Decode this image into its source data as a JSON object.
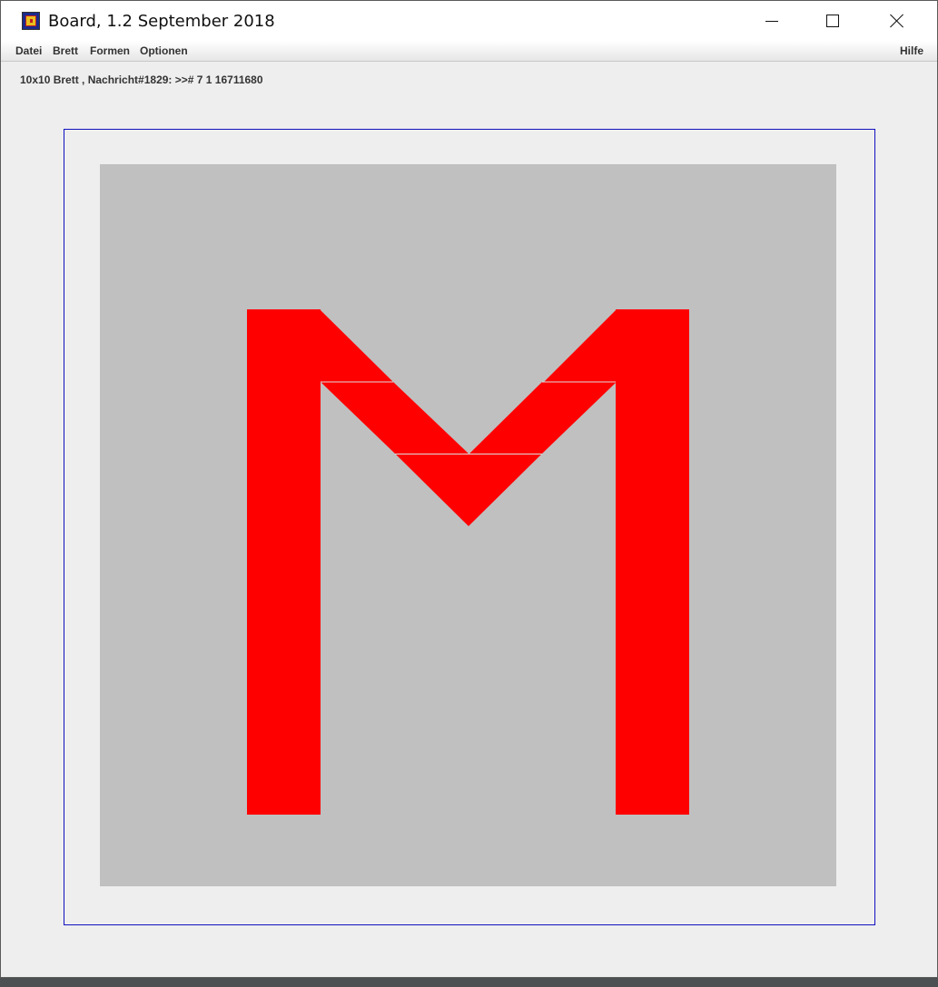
{
  "window": {
    "title": "Board, 1.2 September 2018",
    "icon": "board-app-icon",
    "controls": {
      "minimize": "minimize-icon",
      "maximize": "maximize-icon",
      "close": "close-icon"
    }
  },
  "menubar": {
    "items": [
      {
        "label": "Datei"
      },
      {
        "label": "Brett"
      },
      {
        "label": "Formen"
      },
      {
        "label": "Optionen"
      }
    ],
    "help_label": "Hilfe"
  },
  "status": {
    "text": "10x10 Brett , Nachricht#1829: >># 7 1 16711680"
  },
  "board": {
    "size": "10x10",
    "background_color": "#c0c0c0",
    "frame_color": "#1010c0",
    "shape_color": "#ff0000"
  }
}
